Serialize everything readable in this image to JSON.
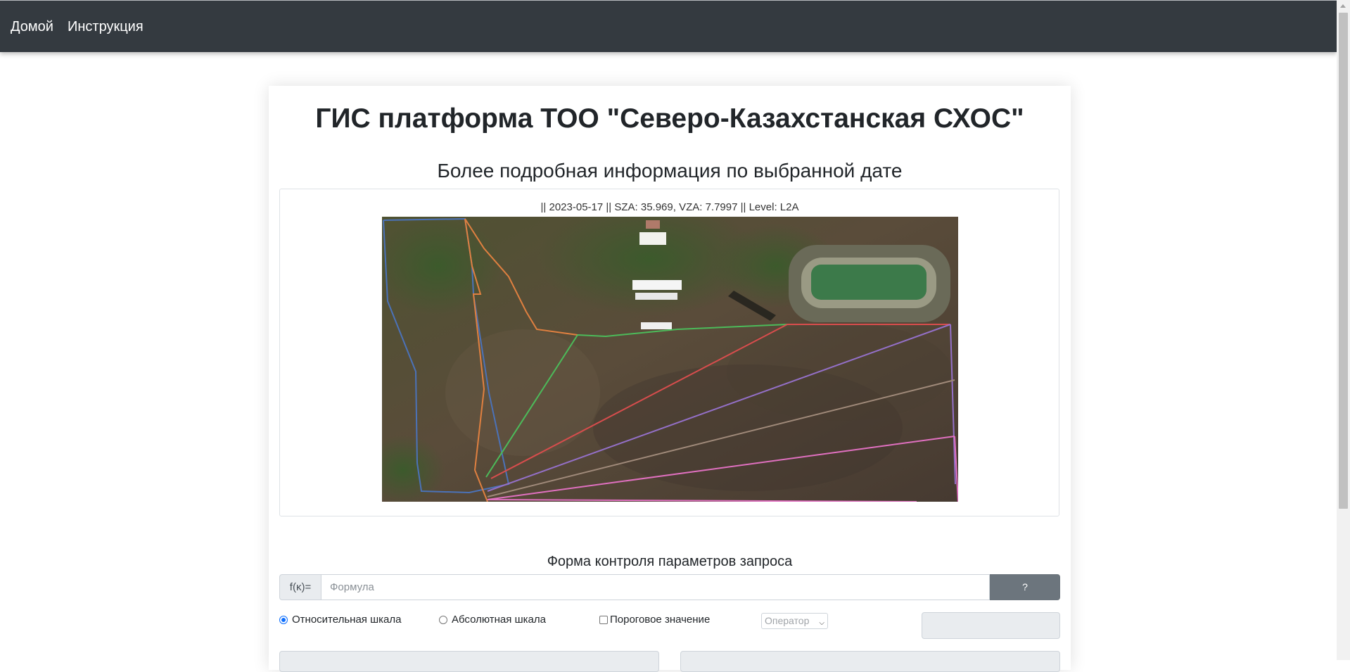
{
  "nav": {
    "home": "Домой",
    "instructions": "Инструкция"
  },
  "page": {
    "title": "ГИС платформа ТОО \"Северо-Казахстанская СХОС\"",
    "subtitle": "Более подробная информация по выбранной дате"
  },
  "image": {
    "caption": "|| 2023-05-17 || SZA: 35.969, VZA: 7.7997 || Level: L2A",
    "field_outline_colors": [
      "#4b72b8",
      "#e08040",
      "#4cbb5a",
      "#d84d4d",
      "#9470c8",
      "#a08a7a",
      "#e070c0"
    ]
  },
  "form": {
    "title": "Форма контроля параметров запроса",
    "prefix": "f(κ)=",
    "formula_placeholder": "Формула",
    "help_label": "?",
    "relative_scale": "Относительная шкала",
    "absolute_scale": "Абсолютная шкала",
    "threshold": "Пороговое значение",
    "operator_placeholder": "Оператор",
    "selected_scale": "relative"
  }
}
